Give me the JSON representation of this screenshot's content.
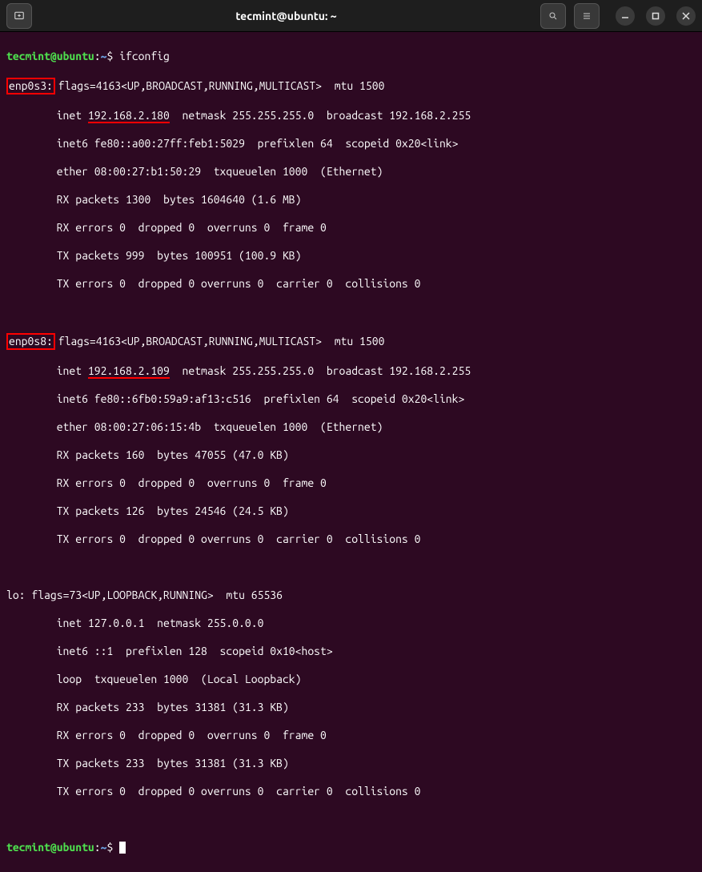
{
  "window": {
    "title": "tecmint@ubuntu: ~"
  },
  "prompt": {
    "user_host": "tecmint@ubuntu",
    "colon": ":",
    "path": "~",
    "dollar": "$ ",
    "command": "ifconfig"
  },
  "interfaces": [
    {
      "name": "enp0s3",
      "highlighted": true,
      "lines": {
        "flags": " flags=4163<UP,BROADCAST,RUNNING,MULTICAST>  mtu 1500",
        "inet_prefix": "        inet ",
        "inet_addr": "192.168.2.180",
        "inet_rest": "  netmask 255.255.255.0  broadcast 192.168.2.255",
        "inet6": "        inet6 fe80::a00:27ff:feb1:5029  prefixlen 64  scopeid 0x20<link>",
        "ether": "        ether 08:00:27:b1:50:29  txqueuelen 1000  (Ethernet)",
        "rxp": "        RX packets 1300  bytes 1604640 (1.6 MB)",
        "rxe": "        RX errors 0  dropped 0  overruns 0  frame 0",
        "txp": "        TX packets 999  bytes 100951 (100.9 KB)",
        "txe": "        TX errors 0  dropped 0 overruns 0  carrier 0  collisions 0"
      }
    },
    {
      "name": "enp0s8",
      "highlighted": true,
      "lines": {
        "flags": " flags=4163<UP,BROADCAST,RUNNING,MULTICAST>  mtu 1500",
        "inet_prefix": "        inet ",
        "inet_addr": "192.168.2.109",
        "inet_rest": "  netmask 255.255.255.0  broadcast 192.168.2.255",
        "inet6": "        inet6 fe80::6fb0:59a9:af13:c516  prefixlen 64  scopeid 0x20<link>",
        "ether": "        ether 08:00:27:06:15:4b  txqueuelen 1000  (Ethernet)",
        "rxp": "        RX packets 160  bytes 47055 (47.0 KB)",
        "rxe": "        RX errors 0  dropped 0  overruns 0  frame 0",
        "txp": "        TX packets 126  bytes 24546 (24.5 KB)",
        "txe": "        TX errors 0  dropped 0 overruns 0  carrier 0  collisions 0"
      }
    },
    {
      "name": "lo:",
      "highlighted": false,
      "lines": {
        "flags": " flags=73<UP,LOOPBACK,RUNNING>  mtu 65536",
        "inet": "        inet 127.0.0.1  netmask 255.0.0.0",
        "inet6": "        inet6 ::1  prefixlen 128  scopeid 0x10<host>",
        "ether": "        loop  txqueuelen 1000  (Local Loopback)",
        "rxp": "        RX packets 233  bytes 31381 (31.3 KB)",
        "rxe": "        RX errors 0  dropped 0  overruns 0  frame 0",
        "txp": "        TX packets 233  bytes 31381 (31.3 KB)",
        "txe": "        TX errors 0  dropped 0 overruns 0  carrier 0  collisions 0"
      }
    }
  ]
}
